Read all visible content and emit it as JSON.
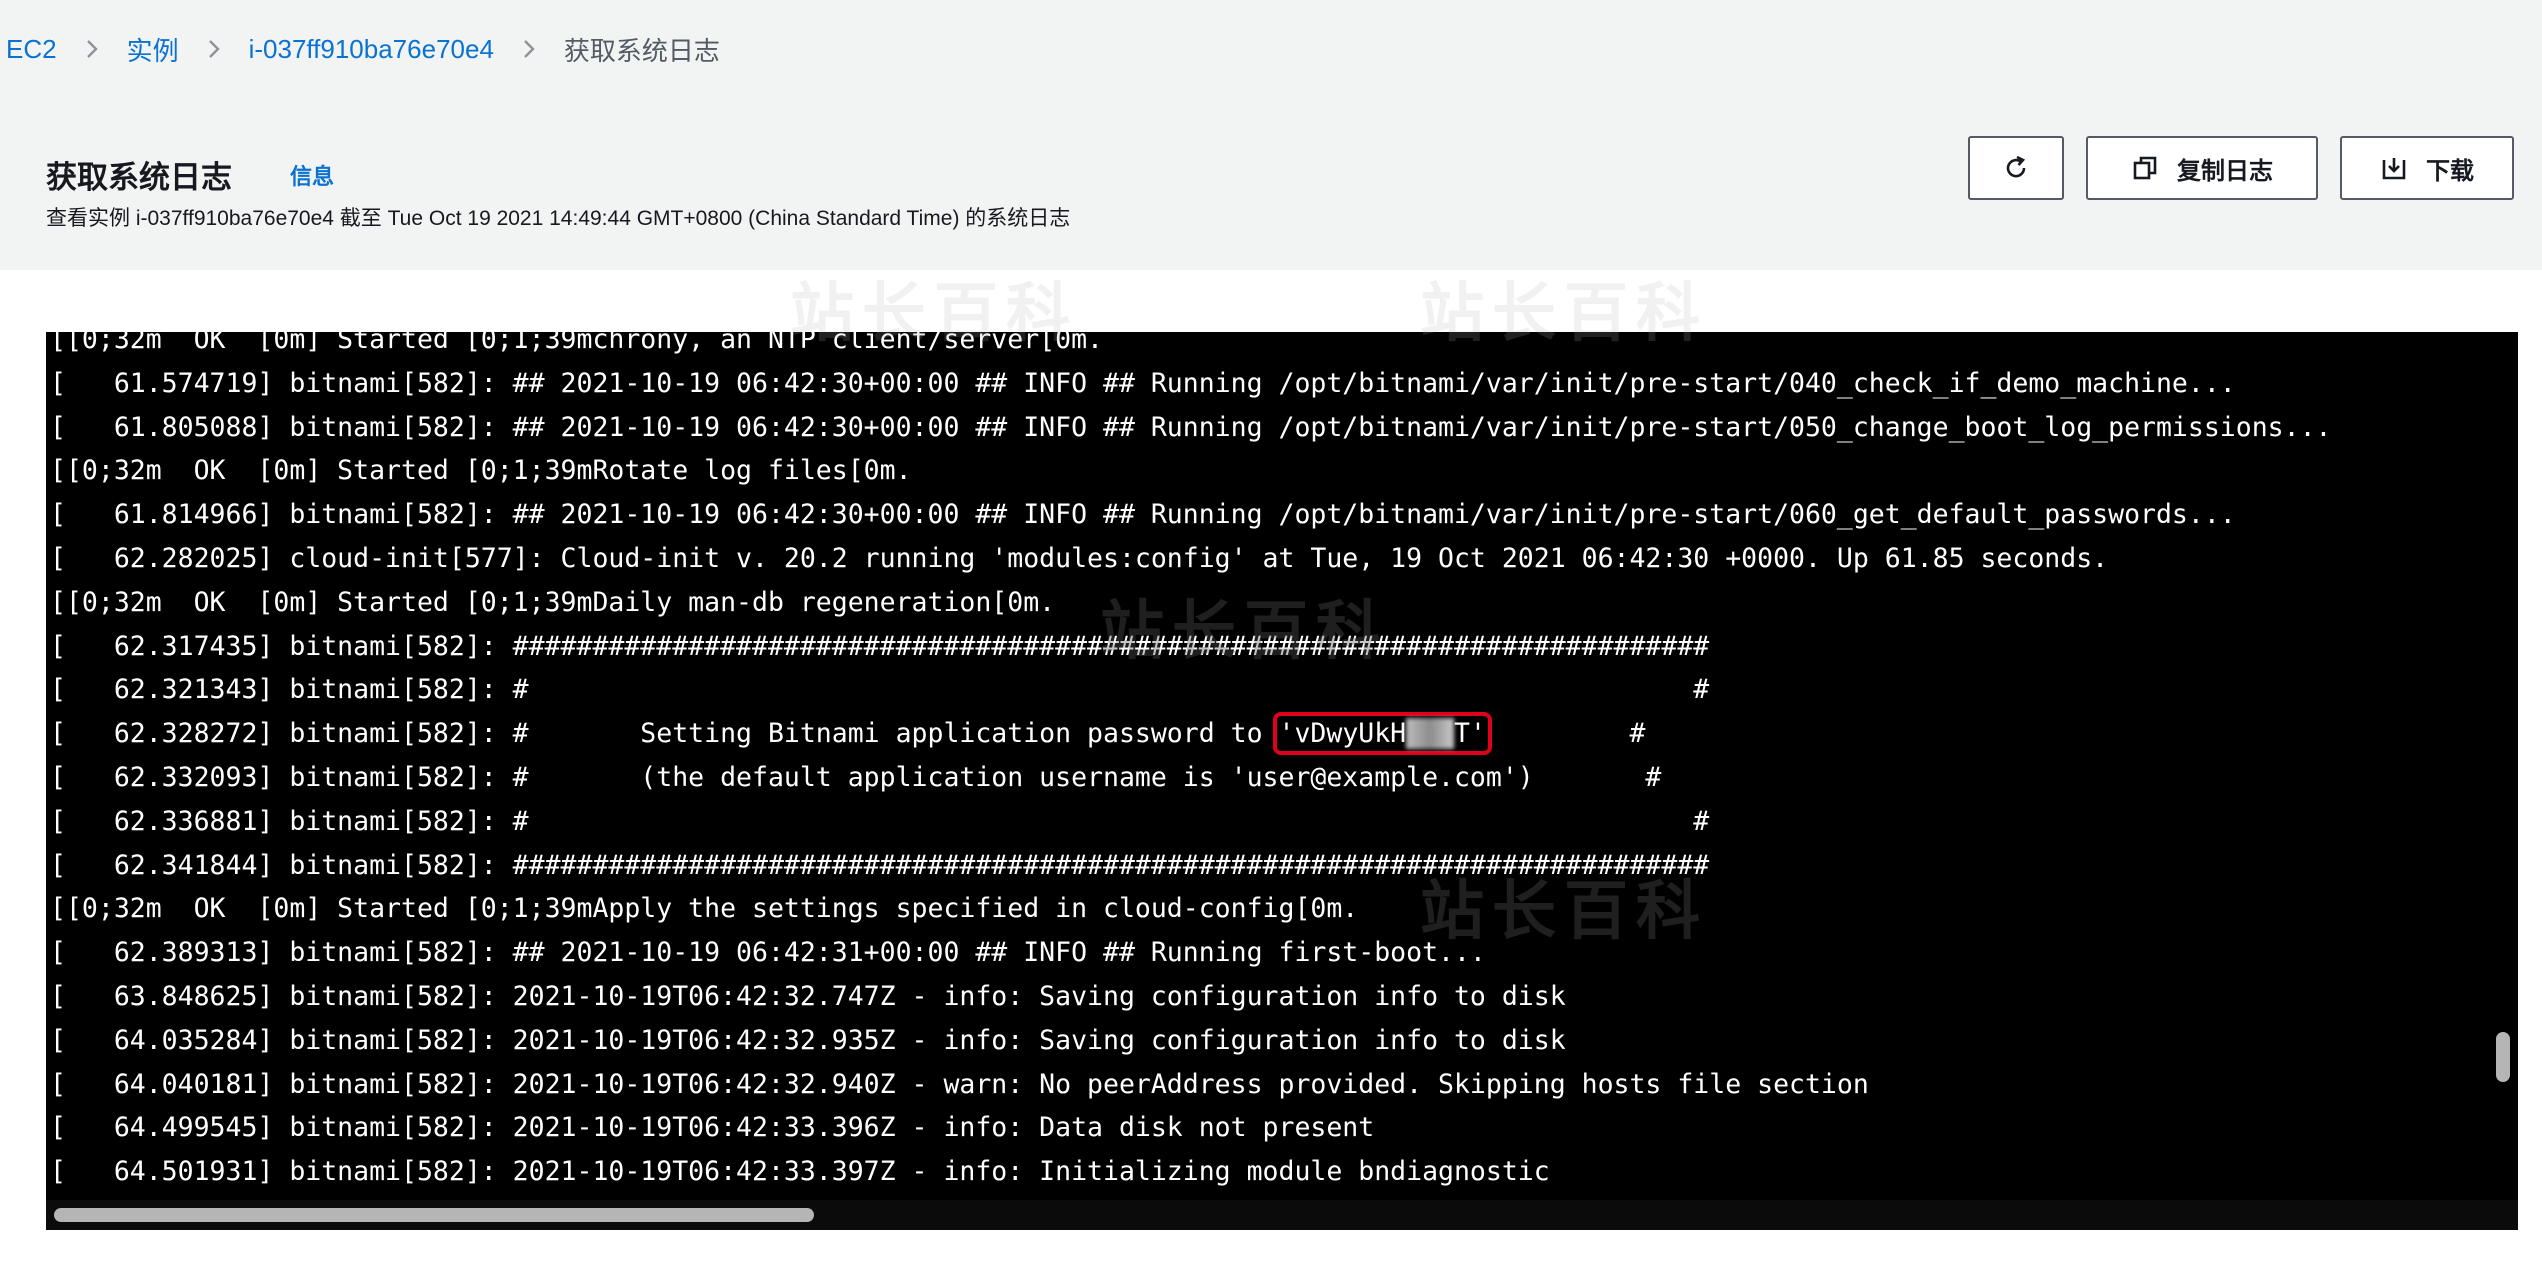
{
  "breadcrumb": {
    "items": [
      "EC2",
      "实例",
      "i-037ff910ba76e70e4"
    ],
    "current": "获取系统日志"
  },
  "header": {
    "title": "获取系统日志",
    "info_link": "信息",
    "description": "查看实例 i-037ff910ba76e70e4 截至 Tue Oct 19 2021 14:49:44 GMT+0800 (China Standard Time) 的系统日志"
  },
  "buttons": {
    "refresh_icon": "refresh-icon",
    "copy_label": "复制日志",
    "copy_icon": "copy-icon",
    "download_label": "下载",
    "download_icon": "download-icon"
  },
  "watermark": "站长百科",
  "log": {
    "lines": [
      "[[0;32m  OK  [0m] Started [0;1;39mchrony, an NTP client/server[0m.",
      "[   61.574719] bitnami[582]: ## 2021-10-19 06:42:30+00:00 ## INFO ## Running /opt/bitnami/var/init/pre-start/040_check_if_demo_machine...",
      "[   61.805088] bitnami[582]: ## 2021-10-19 06:42:30+00:00 ## INFO ## Running /opt/bitnami/var/init/pre-start/050_change_boot_log_permissions...",
      "[[0;32m  OK  [0m] Started [0;1;39mRotate log files[0m.",
      "[   61.814966] bitnami[582]: ## 2021-10-19 06:42:30+00:00 ## INFO ## Running /opt/bitnami/var/init/pre-start/060_get_default_passwords...",
      "[   62.282025] cloud-init[577]: Cloud-init v. 20.2 running 'modules:config' at Tue, 19 Oct 2021 06:42:30 +0000. Up 61.85 seconds.",
      "[[0;32m  OK  [0m] Started [0;1;39mDaily man-db regeneration[0m.",
      "[   62.317435] bitnami[582]: ###########################################################################",
      "[   62.321343] bitnami[582]: #                                                                         #",
      "PASSWORD_LINE",
      "[   62.332093] bitnami[582]: #       (the default application username is 'user@example.com')       #",
      "[   62.336881] bitnami[582]: #                                                                         #",
      "[   62.341844] bitnami[582]: ###########################################################################",
      "[[0;32m  OK  [0m] Started [0;1;39mApply the settings specified in cloud-config[0m.",
      "[   62.389313] bitnami[582]: ## 2021-10-19 06:42:31+00:00 ## INFO ## Running first-boot...",
      "[   63.848625] bitnami[582]: 2021-10-19T06:42:32.747Z - info: Saving configuration info to disk",
      "[   64.035284] bitnami[582]: 2021-10-19T06:42:32.935Z - info: Saving configuration info to disk",
      "[   64.040181] bitnami[582]: 2021-10-19T06:42:32.940Z - warn: No peerAddress provided. Skipping hosts file section",
      "[   64.499545] bitnami[582]: 2021-10-19T06:42:33.396Z - info: Data disk not present",
      "[   64.501931] bitnami[582]: 2021-10-19T06:42:33.397Z - info: Initializing module bndiagnostic"
    ],
    "password_line": {
      "prefix": "[   62.328272] bitnami[582]: #       Setting Bitnami application password to ",
      "password_visible": "'vDwyUkH",
      "password_tail": "T'",
      "suffix": "         #"
    }
  }
}
